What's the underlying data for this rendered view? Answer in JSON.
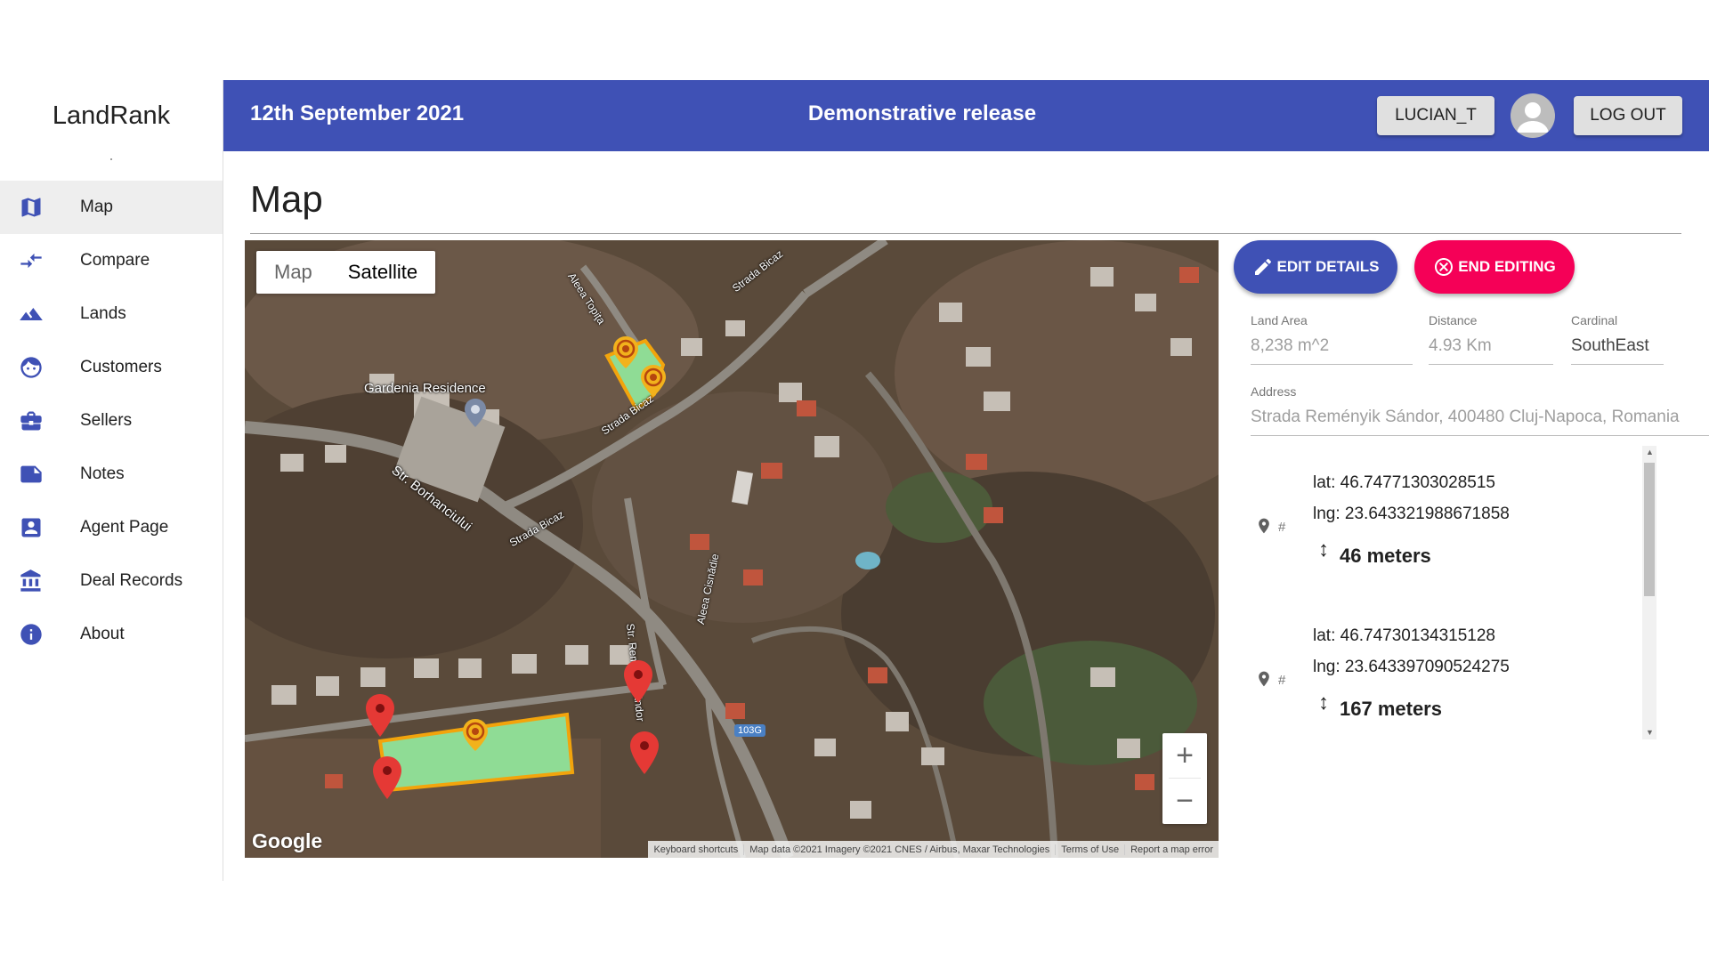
{
  "app": {
    "name": "LandRank"
  },
  "sidebar": {
    "items": [
      {
        "label": "Map",
        "icon": "map-icon",
        "active": true
      },
      {
        "label": "Compare",
        "icon": "compare-arrows-icon"
      },
      {
        "label": "Lands",
        "icon": "landscape-icon"
      },
      {
        "label": "Customers",
        "icon": "face-icon"
      },
      {
        "label": "Sellers",
        "icon": "briefcase-icon"
      },
      {
        "label": "Notes",
        "icon": "note-icon"
      },
      {
        "label": "Agent Page",
        "icon": "contact-badge-icon"
      },
      {
        "label": "Deal Records",
        "icon": "bank-icon"
      },
      {
        "label": "About",
        "icon": "info-icon"
      }
    ]
  },
  "header": {
    "date": "12th September 2021",
    "release": "Demonstrative release",
    "user_label": "LUCIAN_T",
    "logout_label": "LOG OUT",
    "color": "#3f51b5"
  },
  "page": {
    "title": "Map"
  },
  "map": {
    "type_options": [
      "Map",
      "Satellite"
    ],
    "selected_type": "Satellite",
    "labels": {
      "poi": "Gardenia Residence",
      "road1": "Str. Borhanciului",
      "road2": "Strada Bicaz",
      "road3": "Aleea Topiţa",
      "road4": "Strada Bicaz",
      "road5": "Strada Bicaz",
      "road6": "Aleea Cisnădie",
      "road7": "Str. Remény. Sándor",
      "route": "103G"
    },
    "zoom_in": "+",
    "zoom_out": "−",
    "google": "Google",
    "attribution": [
      "Keyboard shortcuts",
      "Map data ©2021 Imagery ©2021 CNES / Airbus, Maxar Technologies",
      "Terms of Use",
      "Report a map error"
    ]
  },
  "actions": {
    "edit_label": "EDIT DETAILS",
    "end_label": "END EDITING",
    "edit_color": "#3f51b5",
    "end_color": "#f50057"
  },
  "details": {
    "land_area_label": "Land Area",
    "land_area_value": "8,238 m^2",
    "distance_label": "Distance",
    "distance_value": "4.93 Km",
    "cardinal_label": "Cardinal",
    "cardinal_value": "SouthEast",
    "address_label": "Address",
    "address_value": "Strada Reményik Sándor, 400480 Cluj-Napoca, Romania"
  },
  "coordinates": [
    {
      "hash": "#",
      "lat": "lat: 46.74771303028515",
      "lng": "lng: 23.643321988671858",
      "distance": "46 meters"
    },
    {
      "hash": "#",
      "lat": "lat: 46.74730134315128",
      "lng": "lng: 23.643397090524275",
      "distance": "167 meters"
    }
  ]
}
